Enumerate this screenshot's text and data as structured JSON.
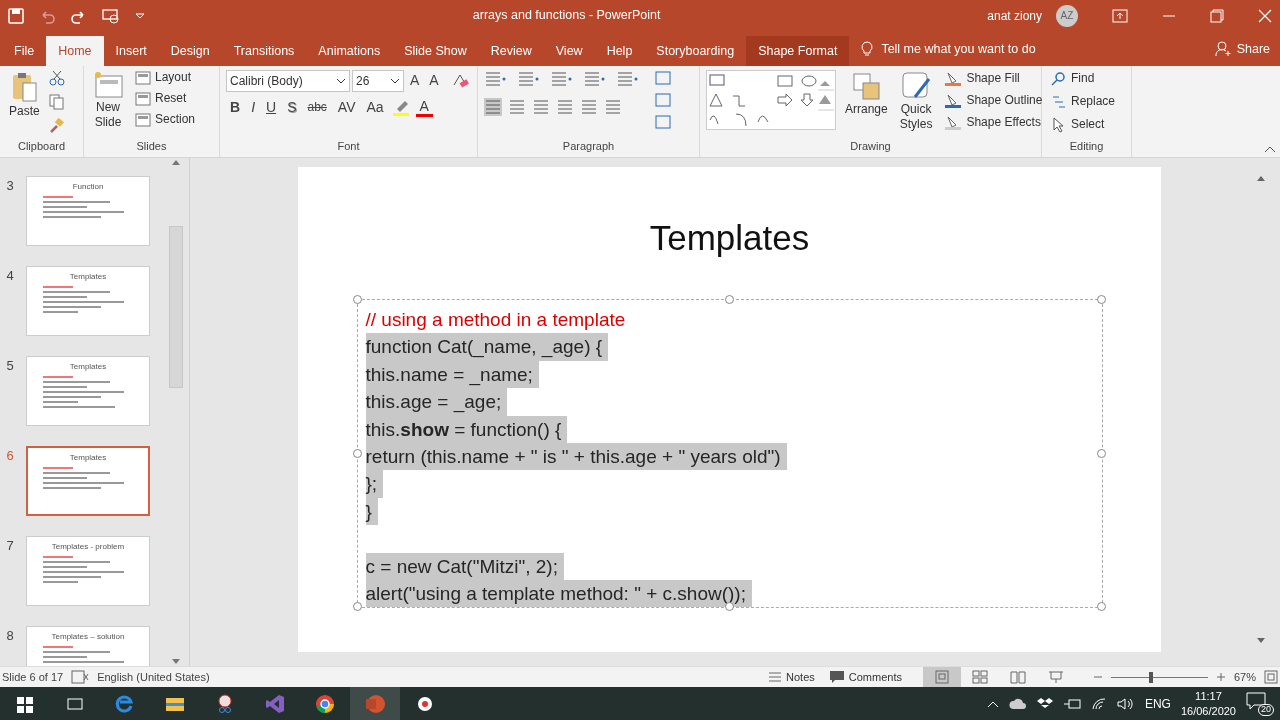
{
  "title_bar": {
    "title": "arrays and functions  -  PowerPoint",
    "user_name": "anat ziony",
    "initials": "AZ"
  },
  "menu_tabs": [
    {
      "label": "File",
      "selected": false,
      "contextual": false
    },
    {
      "label": "Home",
      "selected": true,
      "contextual": false
    },
    {
      "label": "Insert",
      "selected": false,
      "contextual": false
    },
    {
      "label": "Design",
      "selected": false,
      "contextual": false
    },
    {
      "label": "Transitions",
      "selected": false,
      "contextual": false
    },
    {
      "label": "Animations",
      "selected": false,
      "contextual": false
    },
    {
      "label": "Slide Show",
      "selected": false,
      "contextual": false
    },
    {
      "label": "Review",
      "selected": false,
      "contextual": false
    },
    {
      "label": "View",
      "selected": false,
      "contextual": false
    },
    {
      "label": "Help",
      "selected": false,
      "contextual": false
    },
    {
      "label": "Storyboarding",
      "selected": false,
      "contextual": false
    },
    {
      "label": "Shape Format",
      "selected": false,
      "contextual": true
    }
  ],
  "tell_me": "Tell me what you want to do",
  "share": "Share",
  "ribbon": {
    "clipboard": {
      "paste": "Paste",
      "label": "Clipboard"
    },
    "slides": {
      "new_slide": [
        "New",
        "Slide"
      ],
      "layout": "Layout",
      "reset": "Reset",
      "section": "Section",
      "label": "Slides"
    },
    "font": {
      "font_name": "Calibri (Body)",
      "font_size": "26",
      "grow": "A",
      "shrink": "A",
      "styles": [
        "B",
        "I",
        "U",
        "S",
        "abc",
        "AV",
        "Aa"
      ],
      "color_letter": "A",
      "label": "Font"
    },
    "paragraph": {
      "label": "Paragraph"
    },
    "drawing": {
      "arrange": "Arrange",
      "quick_styles": [
        "Quick",
        "Styles"
      ],
      "shape_fill": "Shape Fill",
      "shape_outline": "Shape Outline",
      "shape_effects": "Shape Effects",
      "label": "Drawing"
    },
    "editing": {
      "find": "Find",
      "replace": "Replace",
      "select": "Select",
      "label": "Editing"
    }
  },
  "thumbnails": [
    {
      "number": "3",
      "title": "Function",
      "selected": false
    },
    {
      "number": "4",
      "title": "Templates",
      "selected": false
    },
    {
      "number": "5",
      "title": "Templates",
      "selected": false
    },
    {
      "number": "6",
      "title": "Templates",
      "selected": true
    },
    {
      "number": "7",
      "title": "Templates - problem",
      "selected": false
    },
    {
      "number": "8",
      "title": "Templates – solution",
      "selected": false
    }
  ],
  "slide": {
    "title": "Templates",
    "comment": "// using a method in a template",
    "code_blocks": [
      [
        "function Cat(_name, _age) {",
        "this.name = _name;",
        "this.age = _age;",
        "this.**show** = function() {",
        "return (this.name + \" is \" + this.age + \" years old\")",
        "};",
        "}"
      ],
      [
        "c = new Cat(\"Mitzi\", 2);",
        "alert(\"using a template method: \" + c.show());"
      ]
    ]
  },
  "status_bar": {
    "slide_info": "Slide 6 of 17",
    "language": "English (United States)",
    "notes": "Notes",
    "comments": "Comments",
    "views": [
      {
        "kind": "normal",
        "selected": true
      },
      {
        "kind": "sorter",
        "selected": false
      },
      {
        "kind": "reading",
        "selected": false
      },
      {
        "kind": "show",
        "selected": false
      }
    ],
    "zoom": {
      "level": 0.41
    },
    "zoom_text": "67%"
  },
  "taskbar": {
    "language": "ENG",
    "time": "11:17",
    "date": "16/06/2020",
    "notifications": "20"
  }
}
